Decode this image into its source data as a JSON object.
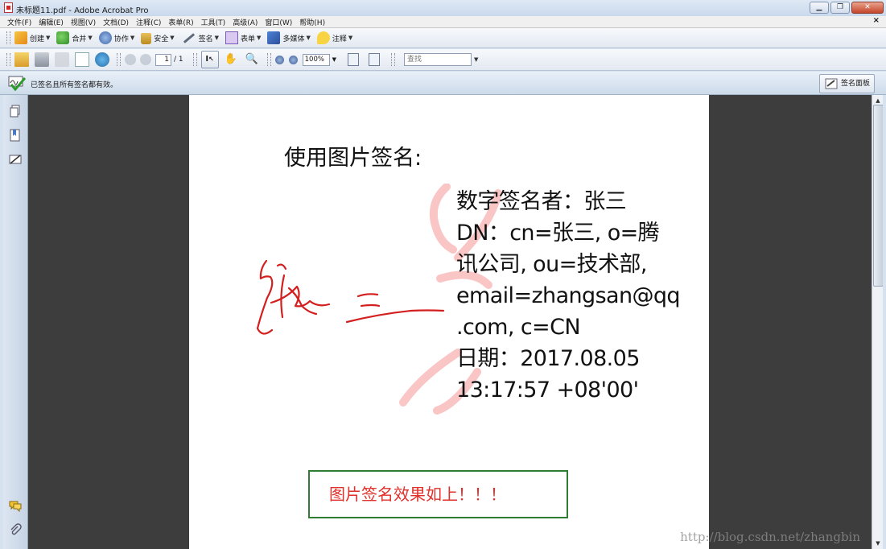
{
  "window": {
    "title": "未标题11.pdf - Adobe Acrobat Pro",
    "minimize_label": "▁",
    "maximize_label": "❐",
    "close_label": "✕"
  },
  "menu": {
    "items": [
      "文件(F)",
      "编辑(E)",
      "视图(V)",
      "文档(D)",
      "注释(C)",
      "表单(R)",
      "工具(T)",
      "高级(A)",
      "窗口(W)",
      "帮助(H)"
    ],
    "close_label": "×"
  },
  "toolbar1": {
    "create": "创建",
    "combine": "合并",
    "collaborate": "协作",
    "secure": "安全",
    "sign": "签名",
    "forms": "表单",
    "multimedia": "多媒体",
    "comment": "注释"
  },
  "toolbar2": {
    "page_current": "1",
    "page_total": "/ 1",
    "zoom": "100%",
    "find_placeholder": "查找"
  },
  "signature_bar": {
    "message": "已签名且所有签名都有效。",
    "panel_button": "签名面板"
  },
  "document": {
    "heading": "使用图片签名:",
    "signature_lines": [
      "数字签名者：张三",
      "DN：cn=张三, o=腾",
      "讯公司, ou=技术部,",
      "email=zhangsan@qq",
      ".com, c=CN",
      "日期：2017.08.05",
      "13:17:57 +08'00'"
    ],
    "result_text": "图片签名效果如上！！！",
    "watermark": "http://blog.csdn.net/zhangbin"
  },
  "colors": {
    "signature_ink": "#d41f1f",
    "result_text": "#e0302a",
    "result_border": "#2f7d32",
    "doc_background": "#3d3d3d"
  }
}
